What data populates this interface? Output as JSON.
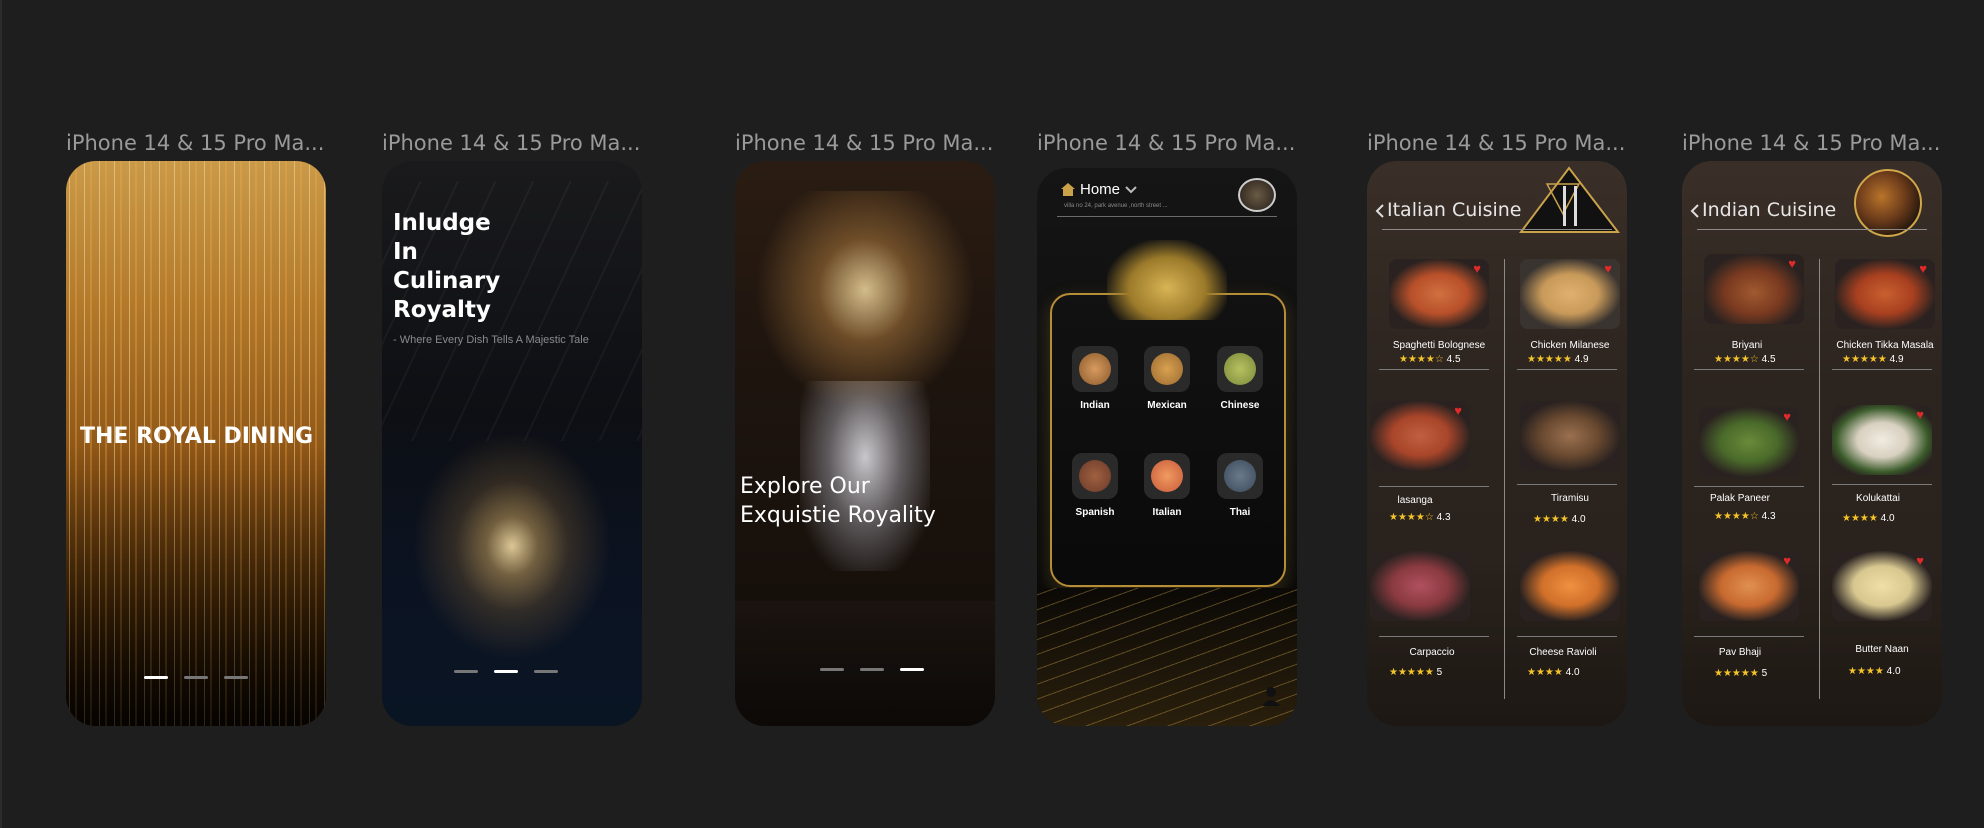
{
  "frames": [
    {
      "label": "iPhone 14 & 15 Pro Ma..."
    },
    {
      "label": "iPhone 14 & 15 Pro Ma..."
    },
    {
      "label": "iPhone 14 & 15 Pro Ma..."
    },
    {
      "label": "iPhone 14 & 15 Pro Ma..."
    },
    {
      "label": "iPhone 14 & 15 Pro Ma..."
    },
    {
      "label": "iPhone 14 & 15 Pro Ma..."
    }
  ],
  "splash1": {
    "title": "THE ROYAL DINING"
  },
  "splash2": {
    "heading_lines": [
      "Inludge",
      "In",
      "Culinary",
      "Royalty"
    ],
    "tagline": "- Where Every Dish Tells A Majestic Tale"
  },
  "splash3": {
    "heading_lines": [
      "Explore Our",
      "Exquistie Royality"
    ]
  },
  "pagination": {
    "active_index_1": 0,
    "active_index_2": 1,
    "active_index_3": 2,
    "count": 3
  },
  "home": {
    "location_label": "Home",
    "address": "villa no 24, park avenue ,north street ...",
    "categories": [
      {
        "name": "Indian",
        "color": "#8a5a2a"
      },
      {
        "name": "Mexican",
        "color": "#9a6a30"
      },
      {
        "name": "Chinese",
        "color": "#7a8a3a"
      },
      {
        "name": "Spanish",
        "color": "#6a3a2a"
      },
      {
        "name": "Italian",
        "color": "#c85a3a"
      },
      {
        "name": "Thai",
        "color": "#3a4a5a"
      }
    ]
  },
  "italian": {
    "title": "Italian Cuisine",
    "dishes": [
      {
        "name": "Spaghetti Bolognese",
        "rating": "4.5",
        "stars": "★★★★☆",
        "color": "#b8502a"
      },
      {
        "name": "Chicken Milanese",
        "rating": "4.9",
        "stars": "★★★★★",
        "color": "#c89a5a"
      },
      {
        "name": "lasanga",
        "rating": "4.3",
        "stars": "★★★★☆",
        "color": "#a8452a"
      },
      {
        "name": "Tiramisu",
        "rating": "4.0",
        "stars": "★★★★",
        "color": "#6a4a30"
      },
      {
        "name": "Carpaccio",
        "rating": "5",
        "stars": "★★★★★",
        "color": "#8a3a40"
      },
      {
        "name": "Cheese Ravioli",
        "rating": "4.0",
        "stars": "★★★★",
        "color": "#d0702a"
      }
    ]
  },
  "indian": {
    "title": "Indian Cuisine",
    "dishes": [
      {
        "name": "Briyani",
        "rating": "4.5",
        "stars": "★★★★☆",
        "color": "#7a3a20"
      },
      {
        "name": "Chicken Tikka Masala",
        "rating": "4.9",
        "stars": "★★★★★",
        "color": "#a84020"
      },
      {
        "name": "Palak Paneer",
        "rating": "4.3",
        "stars": "★★★★☆",
        "color": "#4a6a2a"
      },
      {
        "name": "Kolukattai",
        "rating": "4.0",
        "stars": "★★★★",
        "color": "#d8d0c0"
      },
      {
        "name": "Pav Bhaji",
        "rating": "5",
        "stars": "★★★★★",
        "color": "#c86a30"
      },
      {
        "name": "Butter Naan",
        "rating": "4.0",
        "stars": "★★★★",
        "color": "#d8c890"
      }
    ]
  },
  "icons": {
    "back": "chevron-left-icon",
    "home": "home-icon",
    "dropdown": "chevron-down-icon",
    "heart": "heart-icon",
    "profile": "user-icon"
  }
}
